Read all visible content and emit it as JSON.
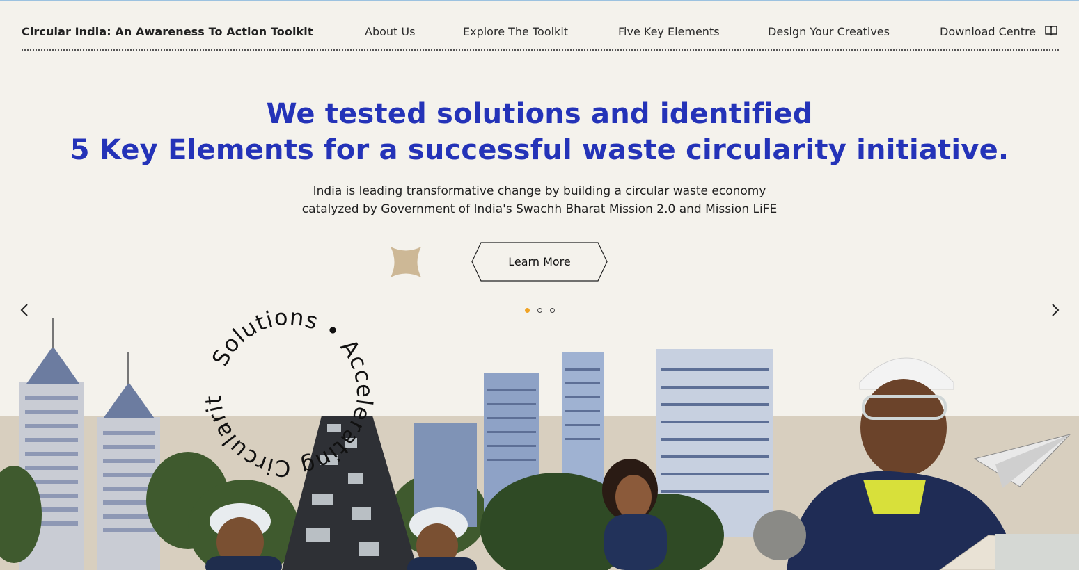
{
  "header": {
    "site_title": "Circular India: An Awareness To Action Toolkit",
    "nav": {
      "about": "About Us",
      "explore": "Explore The Toolkit",
      "five": "Five Key Elements",
      "design": "Design Your Creatives",
      "download": "Download Centre"
    },
    "download_icon": "book-icon"
  },
  "hero": {
    "headline_line1": "We tested solutions and identified",
    "headline_line2": "5 Key Elements for a successful waste circularity initiative.",
    "subtext_line1": "India is leading transformative change by building a circular waste economy",
    "subtext_line2": "catalyzed by Government of India's Swachh Bharat Mission 2.0 and Mission LiFE",
    "cta_label": "Learn More",
    "circular_text": "Solutions • Accelerating Circularity •"
  },
  "carousel": {
    "active_index": 1,
    "count": 3
  },
  "colors": {
    "background": "#f4f2ec",
    "headline": "#2433b8",
    "accent_dot": "#f0a324",
    "sand": "#d8cfbf",
    "star": "#cdb896"
  }
}
